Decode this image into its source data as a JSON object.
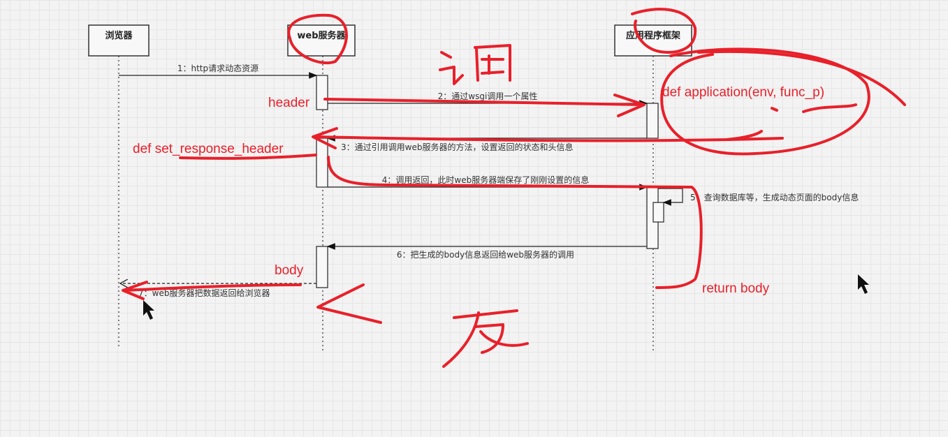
{
  "participants": {
    "browser": "浏览器",
    "web_server": "web服务器",
    "app_framework": "应用程序框架"
  },
  "messages": [
    "1：http请求动态资源",
    "2：通过wsgi调用一个属性",
    "3：通过引用调用web服务器的方法，设置返回的状态和头信息",
    "4：调用返回，此时web服务器端保存了刚刚设置的信息",
    "5：查询数据库等，生成动态页面的body信息",
    "6：把生成的body信息返回给web服务器的调用",
    "7：web服务器把数据返回给浏览器"
  ],
  "annotations": {
    "header": "header",
    "set_response_header": "def set_response_header",
    "application": "def application(env, func_p)",
    "body": "body",
    "return_body": "return body",
    "handwritten_call": "调",
    "handwritten_return": "反"
  },
  "colors": {
    "annotation": "#e8202a",
    "line": "#333333"
  }
}
